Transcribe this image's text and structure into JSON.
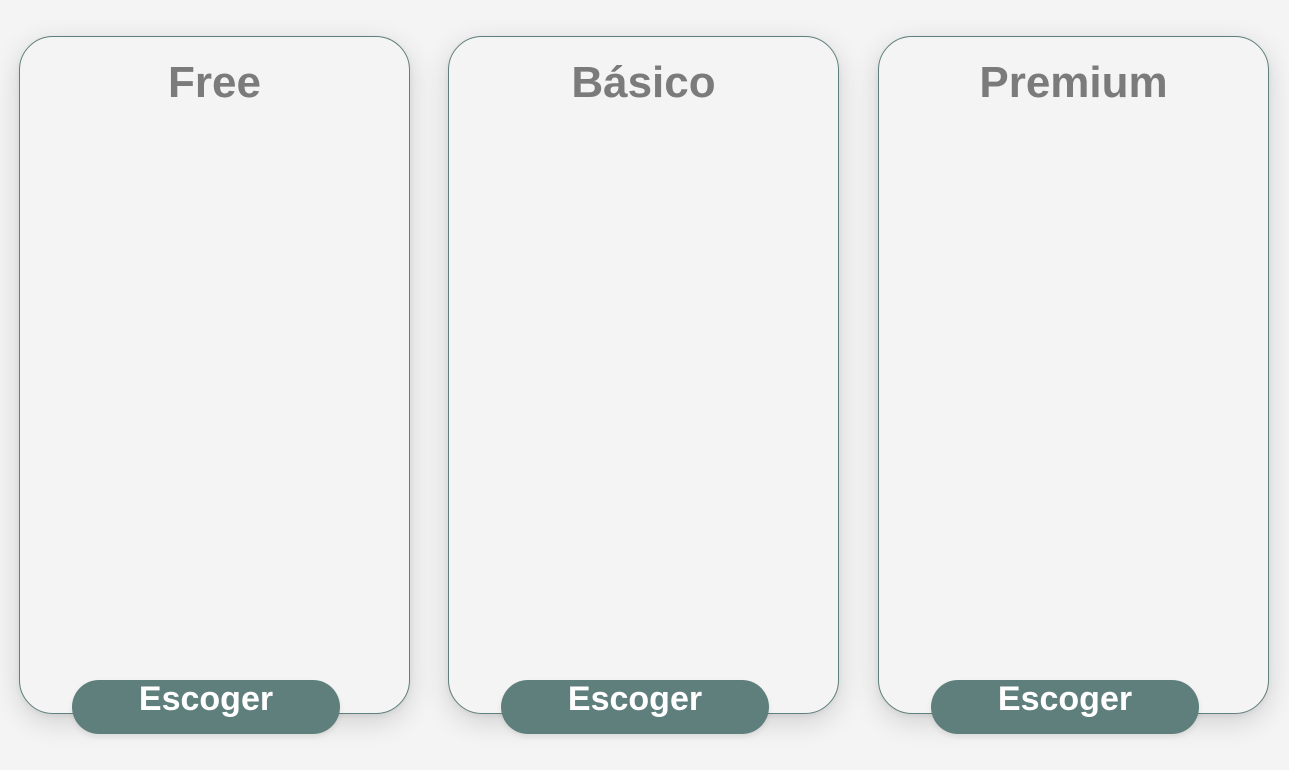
{
  "plans": [
    {
      "title": "Free",
      "button_label": "Escoger"
    },
    {
      "title": "Básico",
      "button_label": "Escoger"
    },
    {
      "title": "Premium",
      "button_label": "Escoger"
    }
  ],
  "colors": {
    "accent": "#5f7f7c",
    "title_text": "#7b7b7b",
    "background": "#f4f4f4",
    "button_text": "#ffffff"
  }
}
